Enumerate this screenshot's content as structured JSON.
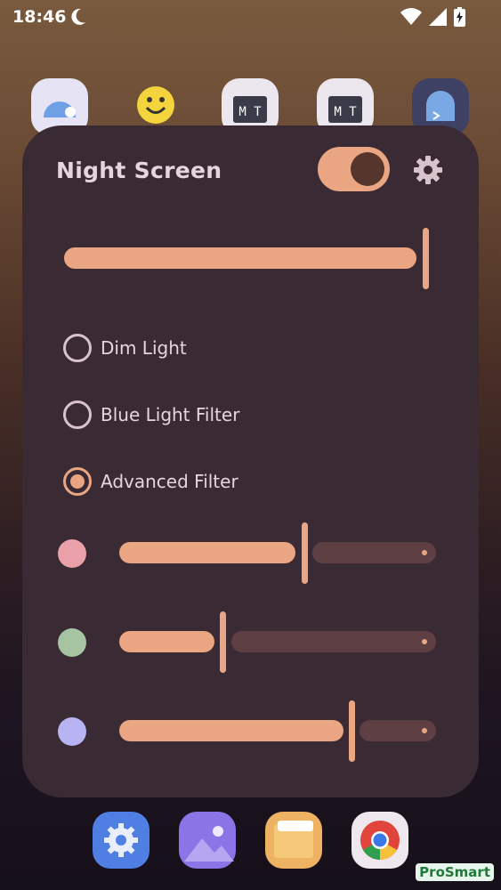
{
  "status_bar": {
    "time": "18:46",
    "icons": [
      "moon-icon",
      "wifi-icon",
      "signal-icon",
      "battery-charging-icon"
    ]
  },
  "home_icons": [
    "android-settings-app-icon",
    "smiley-app-icon",
    "mt-manager-app-icon",
    "mt-manager-app-icon",
    "terminal-app-icon"
  ],
  "panel": {
    "title": "Night Screen",
    "toggle_on": true,
    "master_slider_value": 0.99,
    "options": [
      {
        "label": "Dim Light",
        "selected": false
      },
      {
        "label": "Blue Light Filter",
        "selected": false
      },
      {
        "label": "Advanced Filter",
        "selected": true
      }
    ],
    "channel_sliders": [
      {
        "channel": "red",
        "dot_color": "#e9a0a8",
        "value": 0.58
      },
      {
        "channel": "green",
        "dot_color": "#a6c4a2",
        "value": 0.32
      },
      {
        "channel": "blue",
        "dot_color": "#b8b4f4",
        "value": 0.73
      }
    ]
  },
  "colors": {
    "accent": "#eaa682",
    "panel_bg": "#3a2a34",
    "track_inactive": "#5e3f44"
  },
  "dock_icons": [
    "settings-app-icon",
    "gallery-app-icon",
    "files-app-icon",
    "chrome-app-icon"
  ],
  "watermark": "ProSmart"
}
